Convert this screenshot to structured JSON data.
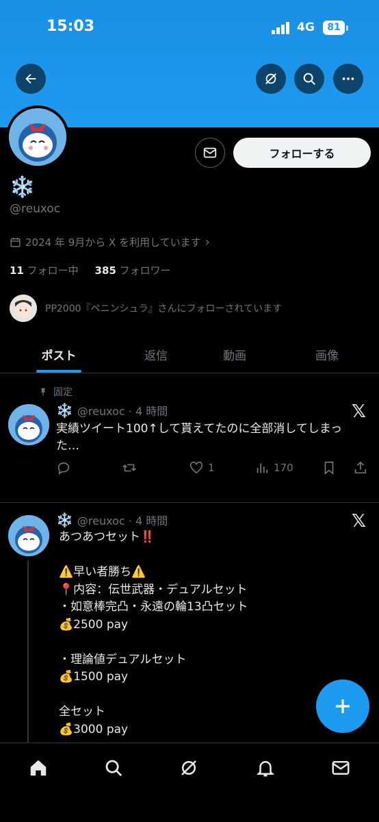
{
  "status": {
    "time": "15:03",
    "network": "4G",
    "battery": "81"
  },
  "header": {
    "back_icon": "arrow-left-icon",
    "grok_icon": "grok-icon",
    "search_icon": "search-icon",
    "more_icon": "more-icon"
  },
  "profile": {
    "display_name": "❄️",
    "handle": "@reuxoc",
    "joined": "2024 年 9月から X を利用しています",
    "following_count": "11",
    "following_label": "フォロー中",
    "followers_count": "385",
    "followers_label": "フォロワー",
    "followed_by": "PP2000『ペニンシュラ』さんにフォローされています",
    "follow_label": "フォローする"
  },
  "tabs": [
    {
      "label": "ポスト",
      "active": true
    },
    {
      "label": "返信",
      "active": false
    },
    {
      "label": "動画",
      "active": false
    },
    {
      "label": "画像",
      "active": false
    }
  ],
  "posts": [
    {
      "pinned_label": "固定",
      "name": "❄️",
      "meta": "@reuxoc · 4 時間",
      "text_line1": "実績ツイート100↑して貰えてたのに全部消してしまっ",
      "text_line2": "た…",
      "likes": "1",
      "views": "170"
    },
    {
      "name": "❄️",
      "meta": "@reuxoc · 4 時間",
      "body": "あつあつセット‼️\n\n⚠️早い者勝ち⚠️\n📍内容：伝世武器・デュアルセット\n・如意棒完凸・永遠の輪13凸セット\n💰2500 pay\n\n・理論値デュアルセット\n💰1500 pay\n\n全セット\n💰3000 pay"
    }
  ],
  "nav": [
    "home-icon",
    "search-icon",
    "grok-icon",
    "notifications-icon",
    "messages-icon"
  ],
  "colors": {
    "accent": "#1d9bf0",
    "background": "#000000",
    "muted": "#71767b"
  }
}
